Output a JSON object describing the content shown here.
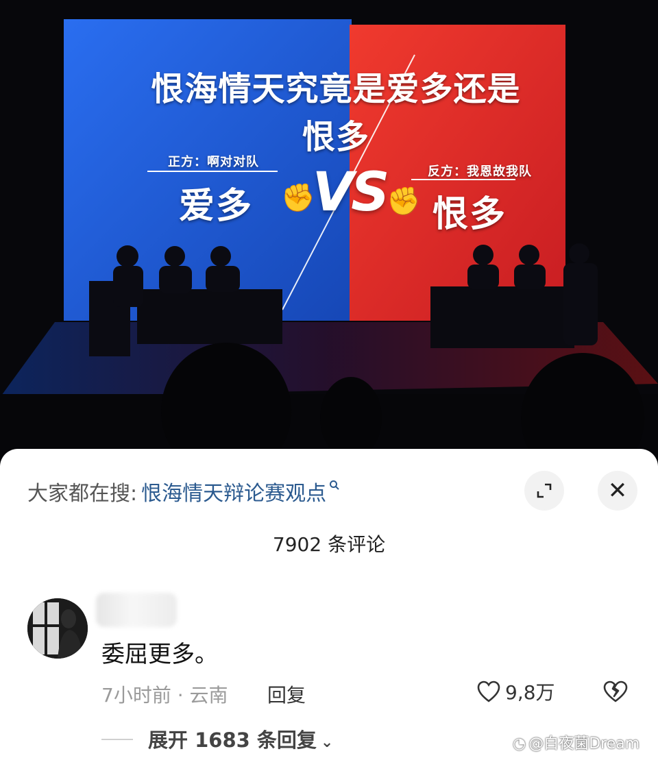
{
  "stage": {
    "screen_title": "恨海情天究竟是爱多还是恨多",
    "affirmative_label": "正方：啊对对队",
    "affirmative_word": "爱多",
    "negative_label": "反方：我恩故我队",
    "negative_word": "恨多",
    "vs": "VS",
    "colors": {
      "blue": "#1f5fd6",
      "red": "#e0282a"
    }
  },
  "search": {
    "prefix": "大家都在搜:",
    "term": "恨海情天辩论赛观点"
  },
  "buttons": {
    "expand_icon": "expand-icon",
    "close_icon": "close-icon",
    "close_glyph": "✕"
  },
  "comments": {
    "count_label": "7902 条评论",
    "items": [
      {
        "text": "委屈更多。",
        "meta": "7小时前 · 云南",
        "reply_label": "回复",
        "likes": "9,8万"
      }
    ],
    "expand_replies": "展开 1683 条回复"
  },
  "watermark": "@白夜菌Dream"
}
